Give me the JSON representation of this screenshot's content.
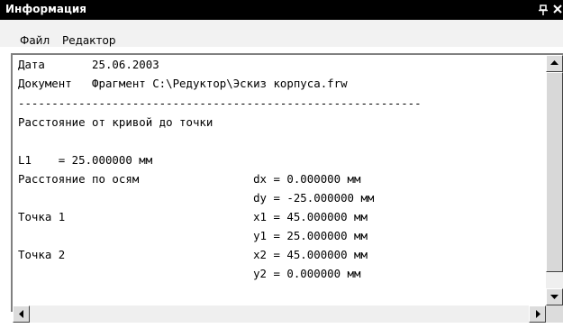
{
  "window": {
    "title": "Информация",
    "pin_glyph": "ᵖ",
    "close_glyph": "×"
  },
  "menu": {
    "file": "Файл",
    "edit": "Редактор"
  },
  "report": {
    "date_line": "Дата       25.06.2003",
    "document_line": "Документ   Фрагмент C:\\Редуктор\\Эскиз корпуса.frw",
    "separator": "------------------------------------------------------------",
    "heading": "Расстояние от кривой до точки",
    "l1_line": "L1    = 25.000000 мм",
    "axes_line": "Расстояние по осям                 dx = 0.000000 мм",
    "dy_line": "                                   dy = -25.000000 мм",
    "point1_x": "Точка 1                            x1 = 45.000000 мм",
    "point1_y": "                                   y1 = 25.000000 мм",
    "point2_x": "Точка 2                            x2 = 45.000000 мм",
    "point2_y": "                                   y2 = 0.000000 мм"
  }
}
